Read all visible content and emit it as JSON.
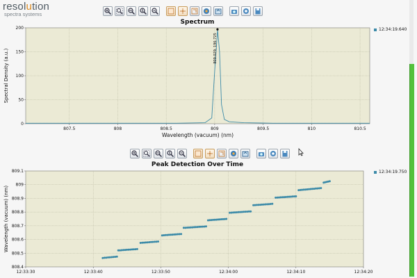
{
  "logo": {
    "main_prefix": "resol",
    "main_accent": "u",
    "main_suffix": "tion",
    "sub": "spectra systems"
  },
  "toolbar_icons": [
    "zoom-in-icon",
    "zoom-box-icon",
    "zoom-x-icon",
    "zoom-y-icon",
    "zoom-out-icon",
    "select-rect-icon",
    "pan-icon",
    "fit-icon",
    "color-icon",
    "export-icon",
    "camera-icon",
    "settings-icon",
    "save-icon"
  ],
  "colors": {
    "series": "#3b8aa8",
    "plot_bg": "#ebead5",
    "grid": "#a8a890",
    "accent_orange": "#d9881e"
  },
  "chart_data": [
    {
      "type": "line",
      "title": "Spectrum",
      "xlabel": "Wavelength (vacuum) (nm)",
      "ylabel": "Spectral Density (a.u.)",
      "xlim": [
        807.05,
        810.6
      ],
      "ylim": [
        0,
        200
      ],
      "x_ticks": [
        "807.5",
        "808",
        "808.5",
        "809",
        "809.5",
        "810",
        "810.5"
      ],
      "x_tick_values": [
        807.5,
        808,
        808.5,
        809,
        809.5,
        810,
        810.5
      ],
      "y_ticks": [
        "0",
        "50",
        "100",
        "150",
        "200"
      ],
      "y_tick_values": [
        0,
        50,
        100,
        150,
        200
      ],
      "series": [
        {
          "name": "12:34:19.640",
          "x": [
            807.05,
            808.0,
            808.6,
            808.9,
            808.97,
            809.0,
            809.03,
            809.05,
            809.07,
            809.1,
            809.15,
            809.3,
            809.6,
            810.0,
            810.6
          ],
          "y": [
            1,
            1,
            1,
            2,
            12,
            110,
            196,
            150,
            40,
            9,
            4,
            2,
            1,
            1,
            1
          ]
        }
      ],
      "annotation": "809.029, 196.725",
      "annotation_x": 809.029,
      "annotation_y": 196.725,
      "grid": true,
      "legend": "top-right"
    },
    {
      "type": "scatter",
      "title": "Peak Detection Over Time",
      "xlabel": "",
      "ylabel": "Wavelength (vacuum) (nm)",
      "xlim": [
        0,
        50
      ],
      "ylim": [
        808.4,
        809.1
      ],
      "x_ticks": [
        "12:33:30",
        "12:33:40",
        "12:33:50",
        "12:34:00",
        "12:34:10",
        "12:34:20"
      ],
      "x_tick_values": [
        0,
        10,
        20,
        30,
        40,
        50
      ],
      "y_ticks": [
        "808.4",
        "808.5",
        "808.6",
        "808.7",
        "808.8",
        "808.9",
        "809",
        "809.1"
      ],
      "y_tick_values": [
        808.4,
        808.5,
        808.6,
        808.7,
        808.8,
        808.9,
        809.0,
        809.1
      ],
      "series": [
        {
          "name": "12:34:19.750",
          "segments": [
            {
              "start": [
                11.4,
                808.465
              ],
              "end": [
                13.5,
                808.475
              ]
            },
            {
              "start": [
                13.7,
                808.52
              ],
              "end": [
                16.5,
                808.53
              ]
            },
            {
              "start": [
                17.0,
                808.575
              ],
              "end": [
                19.6,
                808.585
              ]
            },
            {
              "start": [
                20.2,
                808.63
              ],
              "end": [
                23.0,
                808.64
              ]
            },
            {
              "start": [
                23.4,
                808.685
              ],
              "end": [
                26.7,
                808.695
              ]
            },
            {
              "start": [
                27.0,
                808.74
              ],
              "end": [
                29.7,
                808.75
              ]
            },
            {
              "start": [
                30.2,
                808.795
              ],
              "end": [
                33.3,
                808.805
              ]
            },
            {
              "start": [
                33.7,
                808.85
              ],
              "end": [
                36.5,
                808.86
              ]
            },
            {
              "start": [
                37.0,
                808.905
              ],
              "end": [
                40.0,
                808.915
              ]
            },
            {
              "start": [
                40.4,
                808.96
              ],
              "end": [
                43.7,
                808.975
              ]
            },
            {
              "start": [
                44.1,
                809.015
              ],
              "end": [
                45.0,
                809.025
              ]
            }
          ]
        }
      ],
      "grid": true,
      "legend": "top-right"
    }
  ]
}
